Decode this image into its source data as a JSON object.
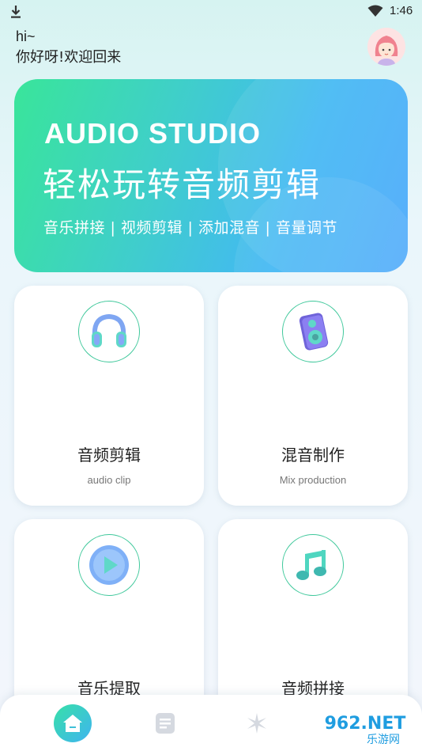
{
  "status_bar": {
    "time": "1:46"
  },
  "greeting": {
    "hi": "hi~",
    "welcome": "你好呀!欢迎回来"
  },
  "banner": {
    "title": "AUDIO STUDIO",
    "subtitle": "轻松玩转音频剪辑",
    "tags": "音乐拼接 | 视频剪辑 | 添加混音 | 音量调节"
  },
  "cards": [
    {
      "title": "音频剪辑",
      "subtitle": "audio clip",
      "icon": "headphones-icon"
    },
    {
      "title": "混音制作",
      "subtitle": "Mix production",
      "icon": "speaker-icon"
    },
    {
      "title": "音乐提取",
      "subtitle": "",
      "icon": "play-icon"
    },
    {
      "title": "音频拼接",
      "subtitle": "",
      "icon": "music-note-icon"
    }
  ],
  "nav": {
    "items": [
      "home-icon",
      "document-icon",
      "sparkle-icon"
    ]
  },
  "watermark": {
    "top": "962.NET",
    "bottom": "乐游网"
  },
  "colors": {
    "accent_green": "#37e0a8",
    "accent_blue": "#3fb4f0",
    "ring": "#3fc89b"
  }
}
